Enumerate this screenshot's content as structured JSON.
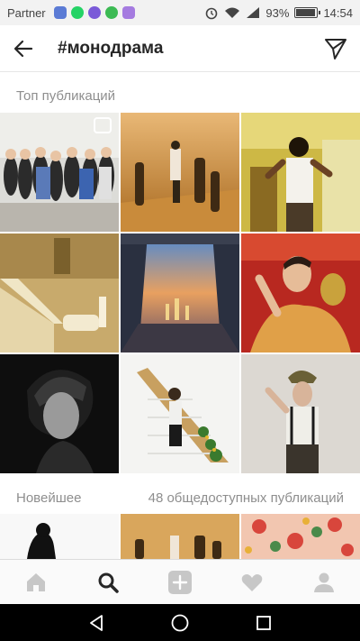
{
  "status_bar": {
    "carrier": "Partner",
    "battery_percent": "93%",
    "time": "14:54",
    "battery_level": 0.93
  },
  "header": {
    "title": "#монодрама"
  },
  "sections": {
    "top_label": "Топ публикаций",
    "newest_label": "Новейшее",
    "public_count": "48 общедоступных публикаций"
  },
  "colors": {
    "accent": "#262626",
    "muted_text": "#8e8e8e",
    "tab_inactive": "#c7c7c7"
  },
  "tabs": [
    {
      "name": "home",
      "icon": "home-icon"
    },
    {
      "name": "search",
      "icon": "search-icon"
    },
    {
      "name": "add",
      "icon": "add-icon"
    },
    {
      "name": "activity",
      "icon": "heart-icon"
    },
    {
      "name": "profile",
      "icon": "profile-icon"
    }
  ]
}
